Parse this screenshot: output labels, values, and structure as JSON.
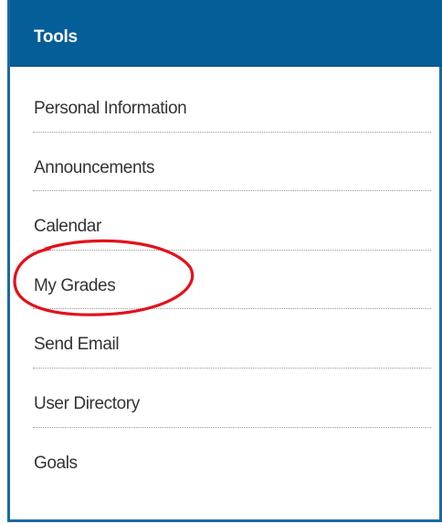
{
  "panel": {
    "title": "Tools"
  },
  "tools": {
    "items": [
      {
        "label": "Personal Information"
      },
      {
        "label": "Announcements"
      },
      {
        "label": "Calendar"
      },
      {
        "label": "My Grades"
      },
      {
        "label": "Send Email"
      },
      {
        "label": "User Directory"
      },
      {
        "label": "Goals"
      }
    ]
  },
  "annotation": {
    "highlighted_item": "My Grades",
    "color": "#e3111a"
  },
  "colors": {
    "header_bg": "#045e97",
    "border": "#1b6aa3",
    "text": "#333333"
  }
}
